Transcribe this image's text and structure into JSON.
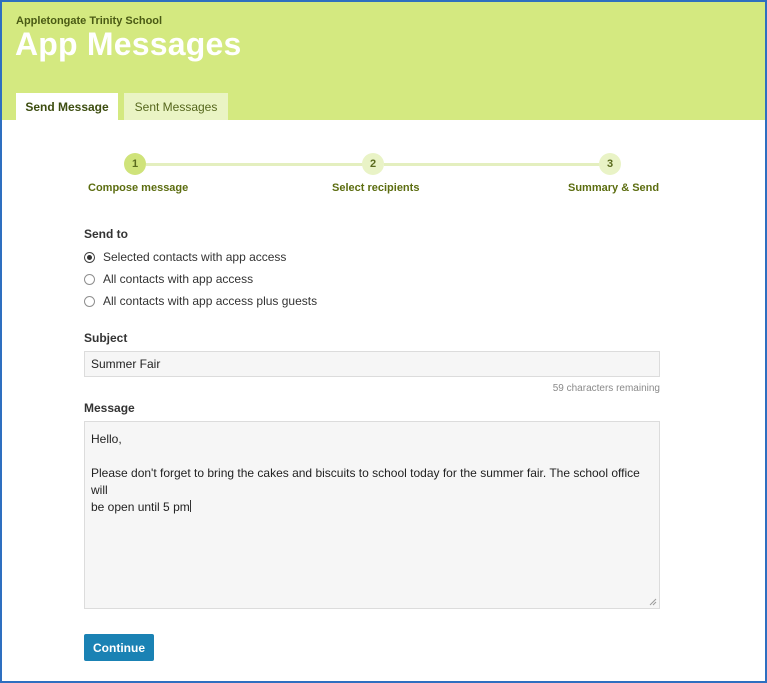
{
  "header": {
    "school_name": "Appletongate Trinity School",
    "app_title": "App Messages",
    "tabs": [
      {
        "label": "Send Message",
        "active": true
      },
      {
        "label": "Sent Messages",
        "active": false
      }
    ]
  },
  "stepper": {
    "current_step": 1,
    "steps": [
      {
        "number": "1",
        "label": "Compose message"
      },
      {
        "number": "2",
        "label": "Select recipients"
      },
      {
        "number": "3",
        "label": "Summary & Send"
      }
    ]
  },
  "send_to": {
    "label": "Send to",
    "selected": "Selected contacts with app access",
    "options": [
      "Selected contacts with app access",
      "All contacts with app access",
      "All contacts with app access plus guests"
    ]
  },
  "subject": {
    "label": "Subject",
    "value": "Summer Fair",
    "chars_remaining": "59 characters remaining"
  },
  "message": {
    "label": "Message",
    "line1": "Hello,",
    "line2": "Please don't forget to bring the cakes and biscuits to school today for the summer fair. The school office will",
    "line3": "be open until 5 pm"
  },
  "continue_label": "Continue",
  "colors": {
    "header_bg": "#d4e980",
    "button_bg": "#1a82b4",
    "frame_border": "#2e6fc0"
  }
}
